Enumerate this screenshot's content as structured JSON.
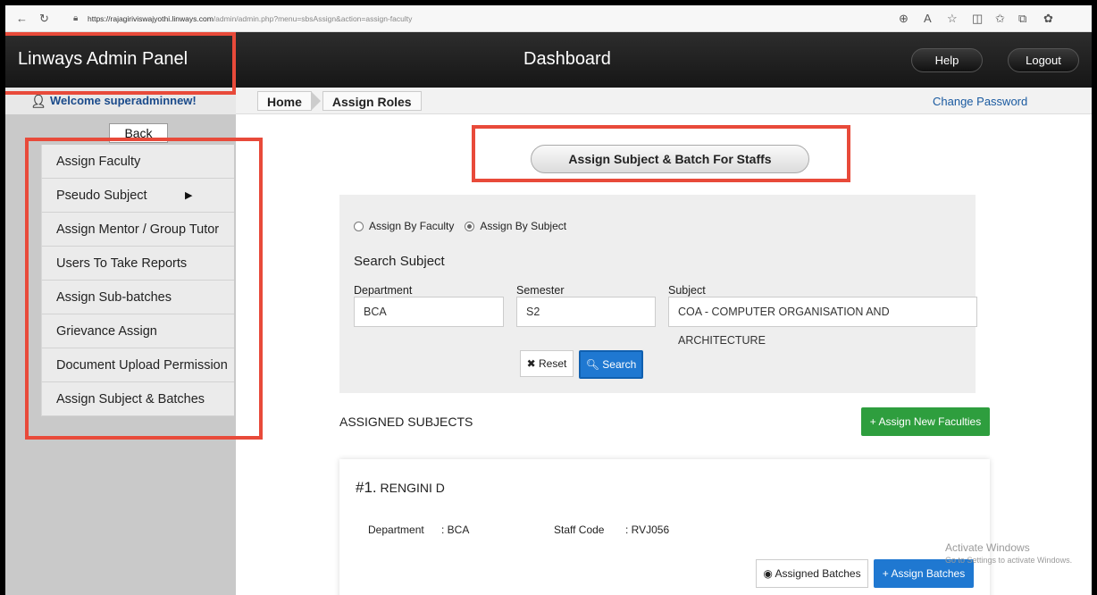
{
  "browser": {
    "url_host": "https://rajagiriviswajyothi.linways.com",
    "url_path": "/admin/admin.php?menu=sbsAssign&action=assign-faculty"
  },
  "header": {
    "brand": "Linways Admin Panel",
    "title": "Dashboard",
    "help_label": "Help",
    "logout_label": "Logout"
  },
  "subbar": {
    "welcome": "Welcome superadminnew!",
    "breadcrumb": [
      "Home",
      "Assign Roles"
    ],
    "change_password": "Change Password"
  },
  "sidebar": {
    "back_label": "Back",
    "items": [
      {
        "label": "Assign Faculty"
      },
      {
        "label": "Pseudo Subject"
      },
      {
        "label": "Assign Mentor / Group Tutor"
      },
      {
        "label": "Users To Take Reports"
      },
      {
        "label": "Assign Sub-batches"
      },
      {
        "label": "Grievance Assign"
      },
      {
        "label": "Document Upload Permission"
      },
      {
        "label": "Assign Subject & Batches"
      }
    ]
  },
  "main": {
    "section_title": "Assign Subject & Batch For Staffs",
    "radios": [
      {
        "label": "Assign By Faculty",
        "selected": false
      },
      {
        "label": "Assign By Subject",
        "selected": true
      }
    ],
    "search_heading": "Search Subject",
    "fields": {
      "department": {
        "label": "Department",
        "value": "BCA"
      },
      "semester": {
        "label": "Semester",
        "value": "S2"
      },
      "subject": {
        "label": "Subject",
        "value": "COA - COMPUTER ORGANISATION AND ARCHITECTURE"
      }
    },
    "reset_label": "Reset",
    "search_label": "Search",
    "assigned_title": "ASSIGNED SUBJECTS",
    "assign_new_label": "Assign New Faculties",
    "card": {
      "number": "#1.",
      "name": "RENGINI D",
      "department_label": "Department",
      "department_value": ": BCA",
      "staff_code_label": "Staff Code",
      "staff_code_value": ": RVJ056",
      "assigned_batches_label": "Assigned Batches",
      "assign_batches_label": "Assign Batches"
    }
  },
  "watermark": {
    "line1": "Activate Windows",
    "line2": "Go to Settings to activate Windows."
  },
  "colors": {
    "annotation": "#e84a3a",
    "primary": "#1f78d1",
    "success": "#2e9e3e"
  }
}
